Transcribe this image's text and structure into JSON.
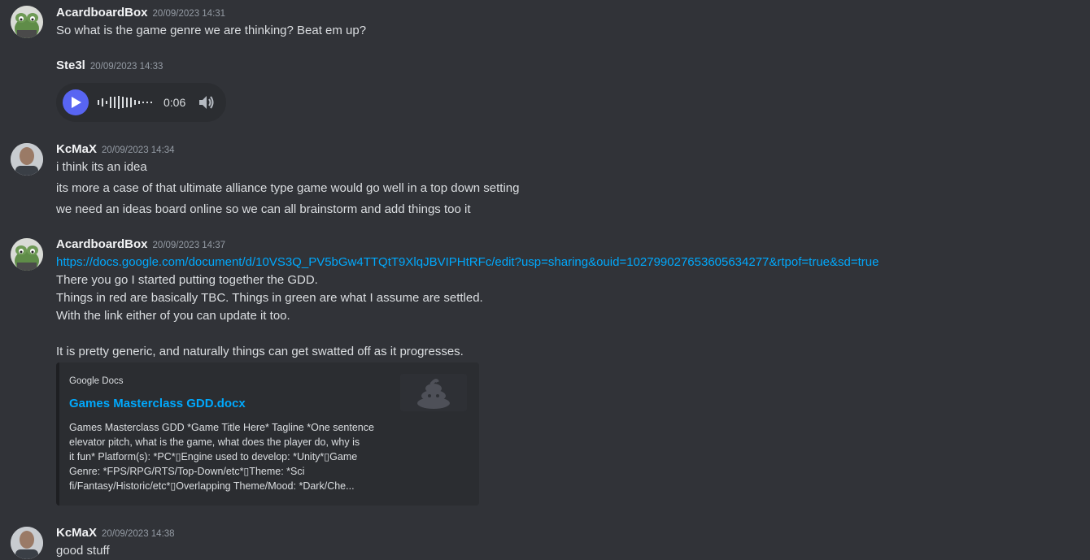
{
  "messages": [
    {
      "author": "AcardboardBox",
      "time": "20/09/2023 14:31",
      "lines": [
        "So what is the game genre we are thinking? Beat em up?"
      ]
    },
    {
      "author": "Ste3l",
      "time": "20/09/2023 14:33",
      "audio": {
        "duration": "0:06"
      }
    },
    {
      "author": "KcMaX",
      "time": "20/09/2023 14:34",
      "lines": [
        "i think its an idea",
        "its more a case of that ultimate alliance type game would go well in a top down setting",
        "we need an ideas board online so we can all brainstorm and add things too it"
      ]
    },
    {
      "author": "AcardboardBox",
      "time": "20/09/2023 14:37",
      "link": "https://docs.google.com/document/d/10VS3Q_PV5bGw4TTQtT9XlqJBVIPHtRFc/edit?usp=sharing&ouid=102799027653605634277&rtpof=true&sd=true",
      "lines": [
        "There you go I started putting together the GDD.",
        "Things in red are basically TBC. Things in green are what I assume are settled.",
        "With the link either of you can update it too.",
        "It is pretty generic, and naturally things can get swatted off as it progresses."
      ],
      "embed": {
        "provider": "Google Docs",
        "title": "Games Masterclass GDD.docx",
        "description": [
          "Games Masterclass GDD *Game Title Here* Tagline *One sentence",
          "elevator pitch, what is the game, what does the player do, why is",
          "it fun* Platform(s): *PC*▯Engine used to develop: *Unity*▯Game",
          "Genre: *FPS/RPG/RTS/Top-Down/etc*▯Theme: *Sci",
          "fi/Fantasy/Historic/etc*▯Overlapping Theme/Mood: *Dark/Che..."
        ]
      }
    },
    {
      "author": "KcMaX",
      "time": "20/09/2023 14:38",
      "lines": [
        "good stuff"
      ]
    }
  ],
  "colors": {
    "background": "#313338",
    "link": "#00a8fc",
    "play_button": "#5865f2",
    "embed_bg": "#2b2d31"
  }
}
